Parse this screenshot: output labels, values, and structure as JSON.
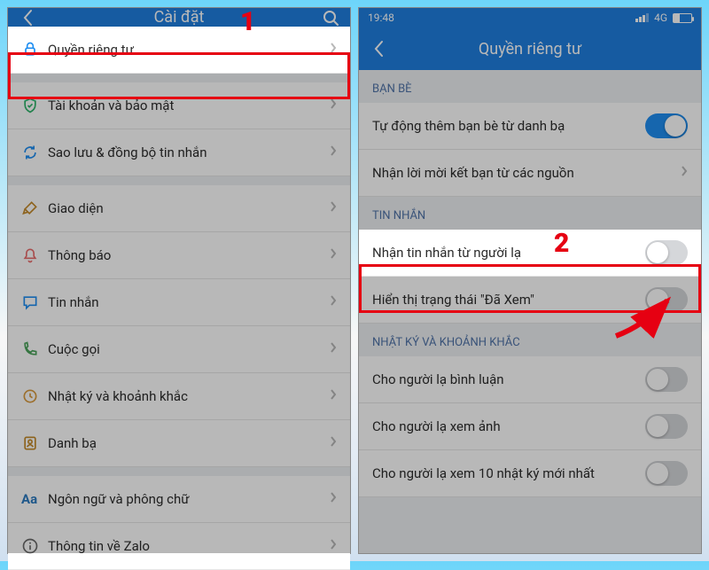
{
  "annotations": {
    "n1": "1",
    "n2": "2"
  },
  "left": {
    "header": {
      "title": "Cài đặt"
    },
    "rows": [
      {
        "icon": "lock-icon",
        "label": "Quyền riêng tư",
        "color": "#1f8ef1"
      },
      {
        "icon": "shield-icon",
        "label": "Tài khoản và bảo mật",
        "color": "#2fb36a"
      },
      {
        "icon": "sync-icon",
        "label": "Sao lưu & đồng bộ tin nhắn",
        "color": "#1f8ef1"
      },
      {
        "icon": "brush-icon",
        "label": "Giao diện",
        "color": "#c48a2a"
      },
      {
        "icon": "bell-icon",
        "label": "Thông báo",
        "color": "#e96c6c"
      },
      {
        "icon": "message-icon",
        "label": "Tin nhắn",
        "color": "#1f8ef1"
      },
      {
        "icon": "phone-icon",
        "label": "Cuộc gọi",
        "color": "#4aa35a"
      },
      {
        "icon": "clock-icon",
        "label": "Nhật ký và khoảnh khắc",
        "color": "#d99a3d"
      },
      {
        "icon": "contacts-icon",
        "label": "Danh bạ",
        "color": "#c48a2a"
      },
      {
        "icon": "font-icon",
        "label": "Ngôn ngữ và phông chữ",
        "color": "#2c7ac0"
      },
      {
        "icon": "info-icon",
        "label": "Thông tin về Zalo",
        "color": "#6a6a6a"
      }
    ]
  },
  "right": {
    "status": {
      "time": "19:48",
      "net": "4G"
    },
    "header": {
      "title": "Quyền riêng tư"
    },
    "sections": {
      "friends": {
        "title": "BẠN BÈ",
        "items": [
          {
            "label": "Tự động thêm bạn bè từ danh bạ",
            "type": "toggle",
            "on": true
          },
          {
            "label": "Nhận lời mời kết bạn từ các nguồn",
            "type": "chev"
          }
        ]
      },
      "messages": {
        "title": "TIN NHẮN",
        "items": [
          {
            "label": "Nhận tin nhắn từ người lạ",
            "type": "toggle",
            "on": false
          },
          {
            "label": "Hiển thị trạng thái \"Đã Xem\"",
            "type": "toggle",
            "on": false
          }
        ]
      },
      "diary": {
        "title": "NHẬT KÝ VÀ KHOẢNH KHẮC",
        "items": [
          {
            "label": "Cho người lạ bình luận",
            "type": "toggle",
            "on": false
          },
          {
            "label": "Cho người lạ xem ảnh",
            "type": "toggle",
            "on": false
          },
          {
            "label": "Cho người lạ xem 10 nhật ký mới nhất",
            "type": "toggle",
            "on": false
          }
        ]
      }
    }
  }
}
